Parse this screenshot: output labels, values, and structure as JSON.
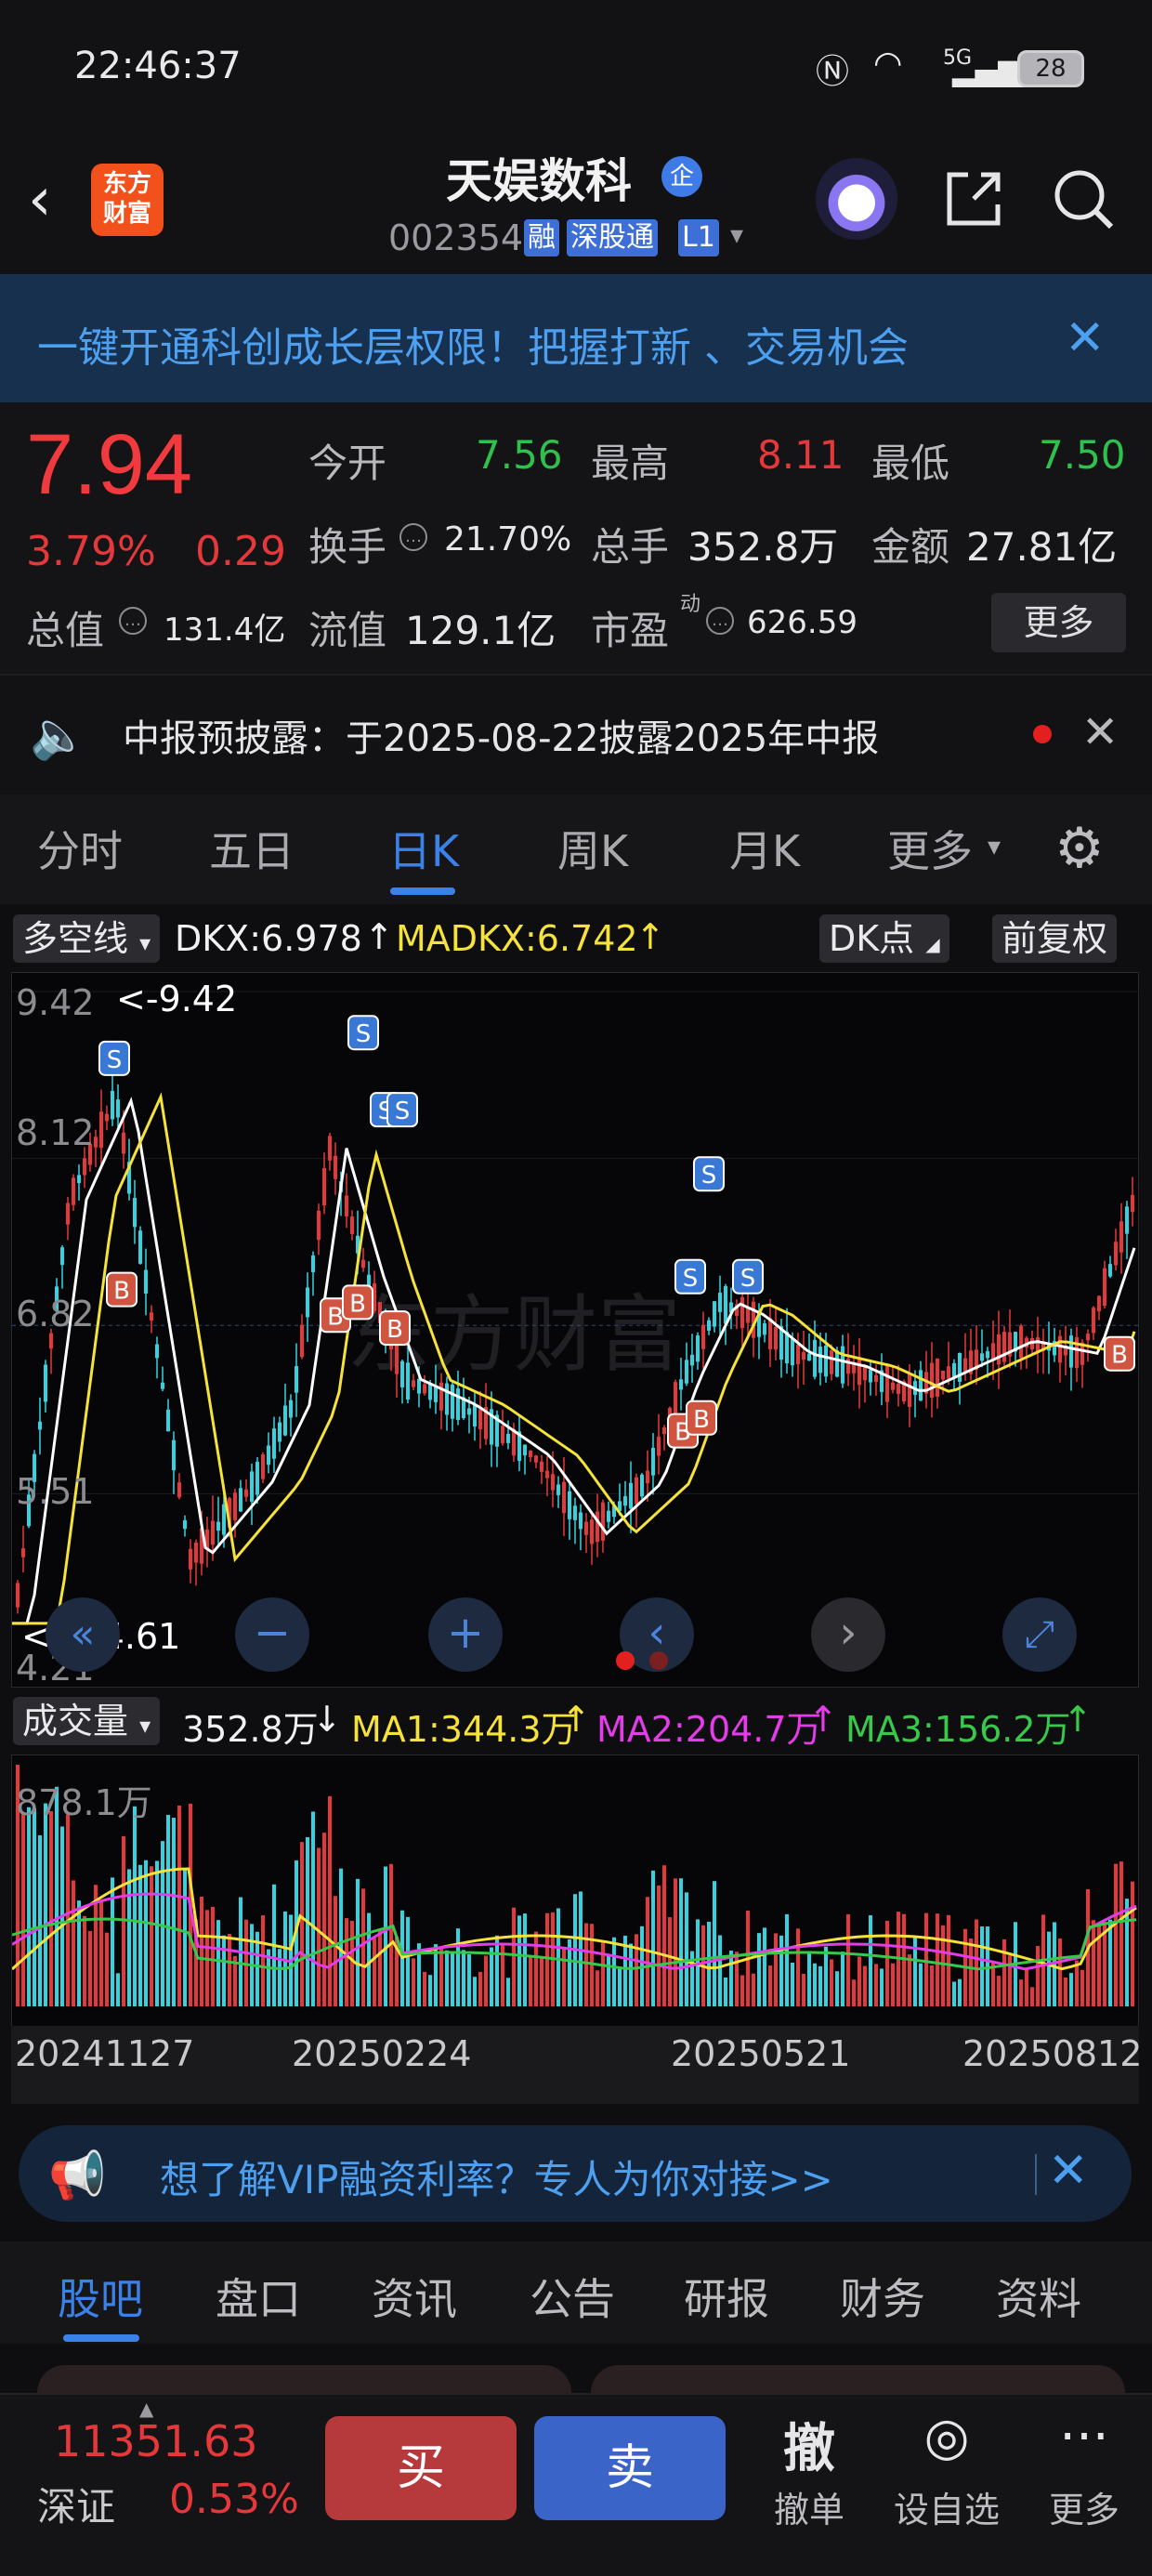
{
  "status_bar": {
    "time": "22:46:37",
    "network": "5G",
    "battery": "28"
  },
  "header": {
    "logo_line1": "东方",
    "logo_line2": "财富",
    "stock_name": "天娱数科",
    "corp_badge": "企",
    "stock_code": "002354",
    "tags": [
      "融",
      "深股通",
      "L1"
    ]
  },
  "promo": {
    "text": "一键开通科创成长层权限！把握打新 、交易机会"
  },
  "quote": {
    "price": "7.94",
    "pct_change": "3.79%",
    "abs_change": "0.29",
    "open_label": "今开",
    "open": "7.56",
    "high_label": "最高",
    "high": "8.11",
    "low_label": "最低",
    "low": "7.50",
    "turnover_label": "换手",
    "turnover": "21.70%",
    "volume_label": "总手",
    "volume": "352.8万",
    "amount_label": "金额",
    "amount": "27.81亿",
    "mktcap_label": "总值",
    "mktcap": "131.4亿",
    "float_label": "流值",
    "float_cap": "129.1亿",
    "pe_label": "市盈",
    "pe_sup": "动",
    "pe": "626.59",
    "more": "更多"
  },
  "notice": {
    "text": "中报预披露：于2025-08-22披露2025年中报"
  },
  "period_tabs": [
    "分时",
    "五日",
    "日K",
    "周K",
    "月K",
    "更多"
  ],
  "active_period": "日K",
  "kline": {
    "indicator_select": "多空线",
    "dkx": "DKX:6.978",
    "madkx": "MADKX:6.742",
    "dk_point": "DK点",
    "adjust": "前复权",
    "y_ticks": [
      "9.42",
      "8.12",
      "6.82",
      "5.51",
      "4.21"
    ],
    "max_label": "<-9.42",
    "min_label": "<----4.61",
    "watermark": "东方财富"
  },
  "volume": {
    "indicator_select": "成交量",
    "vol": "352.8万",
    "ma1": "MA1:344.3万",
    "ma2": "MA2:204.7万",
    "ma3": "MA3:156.2万",
    "max_label": "878.1万"
  },
  "dates": [
    "20241127",
    "20250224",
    "20250521",
    "20250812"
  ],
  "vip": {
    "text": "想了解VIP融资利率？专人为你对接>>"
  },
  "content_tabs": [
    "股吧",
    "盘口",
    "资讯",
    "公告",
    "研报",
    "财务",
    "资料"
  ],
  "bottom": {
    "index_value": "11351.63",
    "index_name": "深证",
    "index_pct": "0.53%",
    "buy": "买",
    "sell": "卖",
    "cancel_icon": "撤",
    "cancel": "撤单",
    "watch": "设自选",
    "more": "更多"
  },
  "colors": {
    "up": "#e5383b",
    "down": "#2ec14c",
    "accent": "#3b82e8",
    "dkx": "#ffffff",
    "madkx": "#f5e23a",
    "ma2": "#e33ce8",
    "ma3": "#39c94a"
  }
}
